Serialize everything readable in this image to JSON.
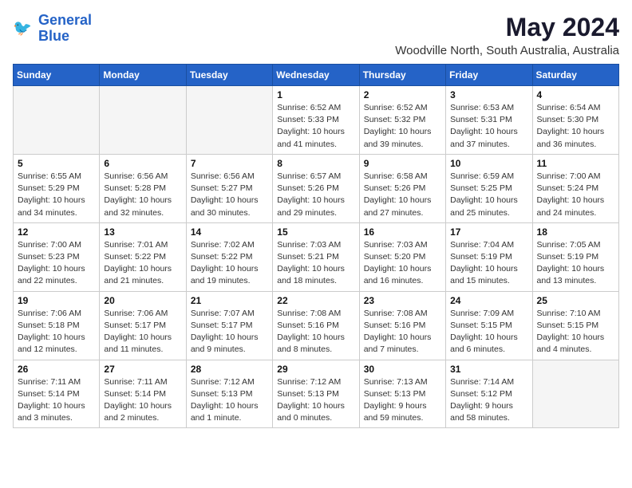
{
  "logo": {
    "text_general": "General",
    "text_blue": "Blue"
  },
  "title": {
    "month_year": "May 2024",
    "location": "Woodville North, South Australia, Australia"
  },
  "weekdays": [
    "Sunday",
    "Monday",
    "Tuesday",
    "Wednesday",
    "Thursday",
    "Friday",
    "Saturday"
  ],
  "weeks": [
    [
      {
        "day": "",
        "sunrise": "",
        "sunset": "",
        "daylight": ""
      },
      {
        "day": "",
        "sunrise": "",
        "sunset": "",
        "daylight": ""
      },
      {
        "day": "",
        "sunrise": "",
        "sunset": "",
        "daylight": ""
      },
      {
        "day": "1",
        "sunrise": "Sunrise: 6:52 AM",
        "sunset": "Sunset: 5:33 PM",
        "daylight": "Daylight: 10 hours and 41 minutes."
      },
      {
        "day": "2",
        "sunrise": "Sunrise: 6:52 AM",
        "sunset": "Sunset: 5:32 PM",
        "daylight": "Daylight: 10 hours and 39 minutes."
      },
      {
        "day": "3",
        "sunrise": "Sunrise: 6:53 AM",
        "sunset": "Sunset: 5:31 PM",
        "daylight": "Daylight: 10 hours and 37 minutes."
      },
      {
        "day": "4",
        "sunrise": "Sunrise: 6:54 AM",
        "sunset": "Sunset: 5:30 PM",
        "daylight": "Daylight: 10 hours and 36 minutes."
      }
    ],
    [
      {
        "day": "5",
        "sunrise": "Sunrise: 6:55 AM",
        "sunset": "Sunset: 5:29 PM",
        "daylight": "Daylight: 10 hours and 34 minutes."
      },
      {
        "day": "6",
        "sunrise": "Sunrise: 6:56 AM",
        "sunset": "Sunset: 5:28 PM",
        "daylight": "Daylight: 10 hours and 32 minutes."
      },
      {
        "day": "7",
        "sunrise": "Sunrise: 6:56 AM",
        "sunset": "Sunset: 5:27 PM",
        "daylight": "Daylight: 10 hours and 30 minutes."
      },
      {
        "day": "8",
        "sunrise": "Sunrise: 6:57 AM",
        "sunset": "Sunset: 5:26 PM",
        "daylight": "Daylight: 10 hours and 29 minutes."
      },
      {
        "day": "9",
        "sunrise": "Sunrise: 6:58 AM",
        "sunset": "Sunset: 5:26 PM",
        "daylight": "Daylight: 10 hours and 27 minutes."
      },
      {
        "day": "10",
        "sunrise": "Sunrise: 6:59 AM",
        "sunset": "Sunset: 5:25 PM",
        "daylight": "Daylight: 10 hours and 25 minutes."
      },
      {
        "day": "11",
        "sunrise": "Sunrise: 7:00 AM",
        "sunset": "Sunset: 5:24 PM",
        "daylight": "Daylight: 10 hours and 24 minutes."
      }
    ],
    [
      {
        "day": "12",
        "sunrise": "Sunrise: 7:00 AM",
        "sunset": "Sunset: 5:23 PM",
        "daylight": "Daylight: 10 hours and 22 minutes."
      },
      {
        "day": "13",
        "sunrise": "Sunrise: 7:01 AM",
        "sunset": "Sunset: 5:22 PM",
        "daylight": "Daylight: 10 hours and 21 minutes."
      },
      {
        "day": "14",
        "sunrise": "Sunrise: 7:02 AM",
        "sunset": "Sunset: 5:22 PM",
        "daylight": "Daylight: 10 hours and 19 minutes."
      },
      {
        "day": "15",
        "sunrise": "Sunrise: 7:03 AM",
        "sunset": "Sunset: 5:21 PM",
        "daylight": "Daylight: 10 hours and 18 minutes."
      },
      {
        "day": "16",
        "sunrise": "Sunrise: 7:03 AM",
        "sunset": "Sunset: 5:20 PM",
        "daylight": "Daylight: 10 hours and 16 minutes."
      },
      {
        "day": "17",
        "sunrise": "Sunrise: 7:04 AM",
        "sunset": "Sunset: 5:19 PM",
        "daylight": "Daylight: 10 hours and 15 minutes."
      },
      {
        "day": "18",
        "sunrise": "Sunrise: 7:05 AM",
        "sunset": "Sunset: 5:19 PM",
        "daylight": "Daylight: 10 hours and 13 minutes."
      }
    ],
    [
      {
        "day": "19",
        "sunrise": "Sunrise: 7:06 AM",
        "sunset": "Sunset: 5:18 PM",
        "daylight": "Daylight: 10 hours and 12 minutes."
      },
      {
        "day": "20",
        "sunrise": "Sunrise: 7:06 AM",
        "sunset": "Sunset: 5:17 PM",
        "daylight": "Daylight: 10 hours and 11 minutes."
      },
      {
        "day": "21",
        "sunrise": "Sunrise: 7:07 AM",
        "sunset": "Sunset: 5:17 PM",
        "daylight": "Daylight: 10 hours and 9 minutes."
      },
      {
        "day": "22",
        "sunrise": "Sunrise: 7:08 AM",
        "sunset": "Sunset: 5:16 PM",
        "daylight": "Daylight: 10 hours and 8 minutes."
      },
      {
        "day": "23",
        "sunrise": "Sunrise: 7:08 AM",
        "sunset": "Sunset: 5:16 PM",
        "daylight": "Daylight: 10 hours and 7 minutes."
      },
      {
        "day": "24",
        "sunrise": "Sunrise: 7:09 AM",
        "sunset": "Sunset: 5:15 PM",
        "daylight": "Daylight: 10 hours and 6 minutes."
      },
      {
        "day": "25",
        "sunrise": "Sunrise: 7:10 AM",
        "sunset": "Sunset: 5:15 PM",
        "daylight": "Daylight: 10 hours and 4 minutes."
      }
    ],
    [
      {
        "day": "26",
        "sunrise": "Sunrise: 7:11 AM",
        "sunset": "Sunset: 5:14 PM",
        "daylight": "Daylight: 10 hours and 3 minutes."
      },
      {
        "day": "27",
        "sunrise": "Sunrise: 7:11 AM",
        "sunset": "Sunset: 5:14 PM",
        "daylight": "Daylight: 10 hours and 2 minutes."
      },
      {
        "day": "28",
        "sunrise": "Sunrise: 7:12 AM",
        "sunset": "Sunset: 5:13 PM",
        "daylight": "Daylight: 10 hours and 1 minute."
      },
      {
        "day": "29",
        "sunrise": "Sunrise: 7:12 AM",
        "sunset": "Sunset: 5:13 PM",
        "daylight": "Daylight: 10 hours and 0 minutes."
      },
      {
        "day": "30",
        "sunrise": "Sunrise: 7:13 AM",
        "sunset": "Sunset: 5:13 PM",
        "daylight": "Daylight: 9 hours and 59 minutes."
      },
      {
        "day": "31",
        "sunrise": "Sunrise: 7:14 AM",
        "sunset": "Sunset: 5:12 PM",
        "daylight": "Daylight: 9 hours and 58 minutes."
      },
      {
        "day": "",
        "sunrise": "",
        "sunset": "",
        "daylight": ""
      }
    ]
  ]
}
